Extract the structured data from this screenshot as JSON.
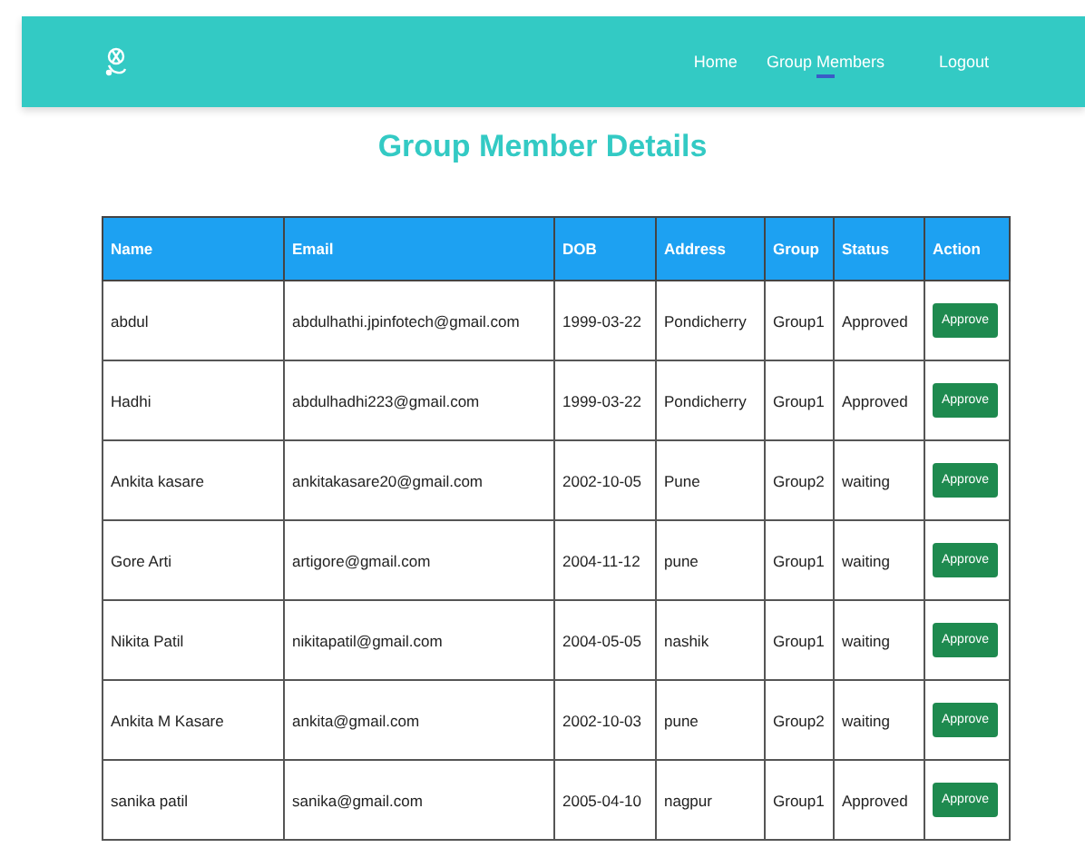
{
  "nav": {
    "links": [
      {
        "label": "Home",
        "selected": false
      },
      {
        "label": "Group Members",
        "selected": true
      },
      {
        "label": "Logout",
        "selected": false
      }
    ]
  },
  "title": "Group Member Details",
  "table": {
    "columns": [
      "Name",
      "Email",
      "DOB",
      "Address",
      "Group",
      "Status",
      "Action"
    ],
    "rows": [
      {
        "name": "abdul",
        "email": "abdulhathi.jpinfotech@gmail.com",
        "dob": "1999-03-22",
        "address": "Pondicherry",
        "group": "Group1",
        "status": "Approved",
        "action": "Approve"
      },
      {
        "name": "Hadhi",
        "email": "abdulhadhi223@gmail.com",
        "dob": "1999-03-22",
        "address": "Pondicherry",
        "group": "Group1",
        "status": "Approved",
        "action": "Approve"
      },
      {
        "name": "Ankita kasare",
        "email": "ankitakasare20@gmail.com",
        "dob": "2002-10-05",
        "address": "Pune",
        "group": "Group2",
        "status": "waiting",
        "action": "Approve"
      },
      {
        "name": "Gore Arti",
        "email": "artigore@gmail.com",
        "dob": "2004-11-12",
        "address": "pune",
        "group": "Group1",
        "status": "waiting",
        "action": "Approve"
      },
      {
        "name": "Nikita Patil",
        "email": "nikitapatil@gmail.com",
        "dob": "2004-05-05",
        "address": "nashik",
        "group": "Group1",
        "status": "waiting",
        "action": "Approve"
      },
      {
        "name": "Ankita M Kasare",
        "email": "ankita@gmail.com",
        "dob": "2002-10-03",
        "address": "pune",
        "group": "Group2",
        "status": "waiting",
        "action": "Approve"
      },
      {
        "name": "sanika patil",
        "email": "sanika@gmail.com",
        "dob": "2005-04-10",
        "address": "nagpur",
        "group": "Group1",
        "status": "Approved",
        "action": "Approve"
      }
    ]
  }
}
